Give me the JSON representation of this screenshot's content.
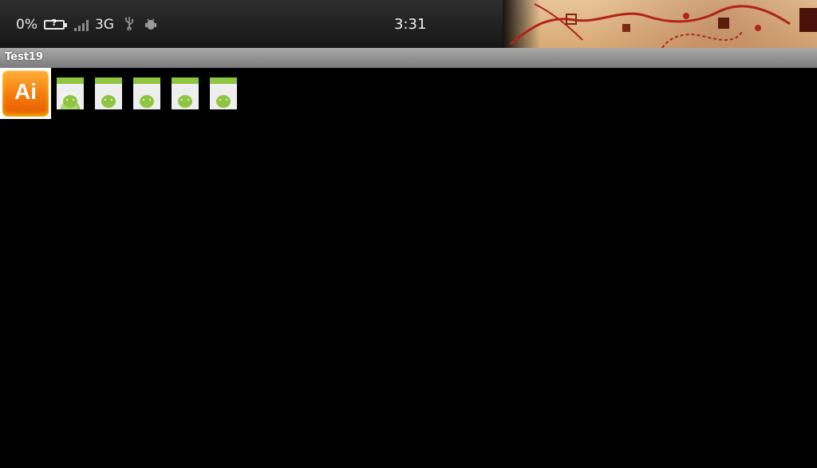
{
  "status_bar": {
    "battery_percent": "0%",
    "battery_state_symbol": "?",
    "network_type": "3G",
    "time": "3:31",
    "signal_bars_active": 0,
    "icons": [
      "battery-unknown-icon",
      "signal-icon",
      "usb-icon",
      "android-debug-icon"
    ]
  },
  "title_bar": {
    "title": "Test19"
  },
  "content": {
    "selected_app_label": "Ai",
    "file_items": [
      {
        "icon": "android-apk-icon"
      },
      {
        "icon": "android-apk-icon"
      },
      {
        "icon": "android-apk-icon"
      },
      {
        "icon": "android-apk-icon"
      },
      {
        "icon": "android-apk-icon"
      }
    ]
  },
  "colors": {
    "background": "#000000",
    "title_bar": "#8e8e8e",
    "ai_orange": "#f47a0a",
    "android_green": "#8ec641"
  }
}
